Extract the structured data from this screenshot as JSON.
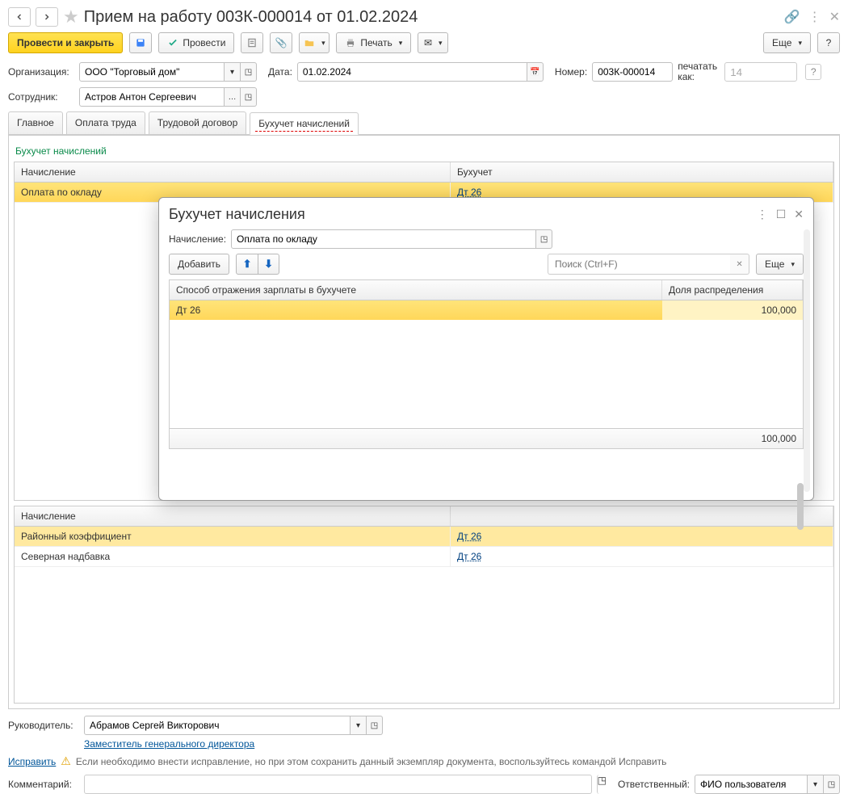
{
  "title": "Прием на работу 003К-000014 от 01.02.2024",
  "toolbar": {
    "post_close": "Провести и закрыть",
    "post": "Провести",
    "print": "Печать",
    "more": "Еще"
  },
  "header": {
    "org_label": "Организация:",
    "org_value": "ООО \"Торговый дом\"",
    "date_label": "Дата:",
    "date_value": "01.02.2024",
    "num_label": "Номер:",
    "num_value": "003К-000014",
    "print_as_label": "печатать как:",
    "print_as_value": "14",
    "employee_label": "Сотрудник:",
    "employee_value": "Астров Антон Сергеевич"
  },
  "tabs": {
    "items": [
      "Главное",
      "Оплата труда",
      "Трудовой договор",
      "Бухучет начислений"
    ],
    "active": 3
  },
  "section_label": "Бухучет начислений",
  "grid1": {
    "cols": [
      "Начисление",
      "Бухучет"
    ],
    "rows": [
      {
        "n": "Оплата по окладу",
        "b": "Дт 26"
      }
    ]
  },
  "grid2": {
    "cols": [
      "Начисление"
    ],
    "rows": [
      {
        "n": "Районный коэффициент",
        "b": "Дт 26"
      },
      {
        "n": "Северная надбавка",
        "b": "Дт 26"
      }
    ]
  },
  "footer": {
    "manager_label": "Руководитель:",
    "manager_value": "Абрамов Сергей Викторович",
    "position": "Заместитель генерального директора",
    "fix_link": "Исправить",
    "warn_text": "Если необходимо внести исправление, но при этом сохранить данный экземпляр документа, воспользуйтесь командой Исправить",
    "comment_label": "Комментарий:",
    "comment_value": "",
    "responsible_label": "Ответственный:",
    "responsible_value": "ФИО пользователя"
  },
  "modal": {
    "title": "Бухучет начисления",
    "accrual_label": "Начисление:",
    "accrual_value": "Оплата по окладу",
    "add": "Добавить",
    "search_ph": "Поиск (Ctrl+F)",
    "more": "Еще",
    "cols": [
      "Способ отражения зарплаты в бухучете",
      "Доля распределения"
    ],
    "row": {
      "method": "Дт 26",
      "share": "100,000"
    },
    "total": "100,000"
  }
}
